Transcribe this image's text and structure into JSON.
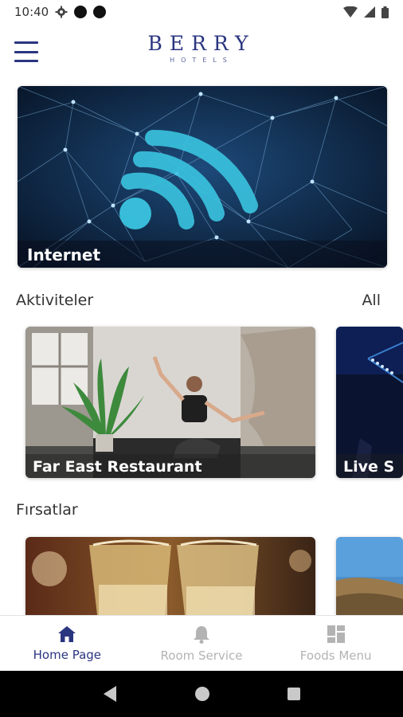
{
  "status_bar": {
    "time": "10:40"
  },
  "header": {
    "logo_main": "BERRY",
    "logo_sub": "HOTELS"
  },
  "hero": {
    "label": "Internet"
  },
  "activities": {
    "title": "Aktiviteler",
    "all_label": "All",
    "cards": [
      {
        "label": "Far East Restaurant"
      },
      {
        "label": "Live S"
      }
    ]
  },
  "offers": {
    "title": "Fırsatlar"
  },
  "bottom_nav": {
    "items": [
      {
        "label": "Home Page",
        "icon": "home-icon",
        "active": true
      },
      {
        "label": "Room Service",
        "icon": "bell-icon",
        "active": false
      },
      {
        "label": "Foods Menu",
        "icon": "grid-icon",
        "active": false
      }
    ]
  },
  "colors": {
    "brand": "#2a3580",
    "inactive": "#b3b3b3"
  }
}
